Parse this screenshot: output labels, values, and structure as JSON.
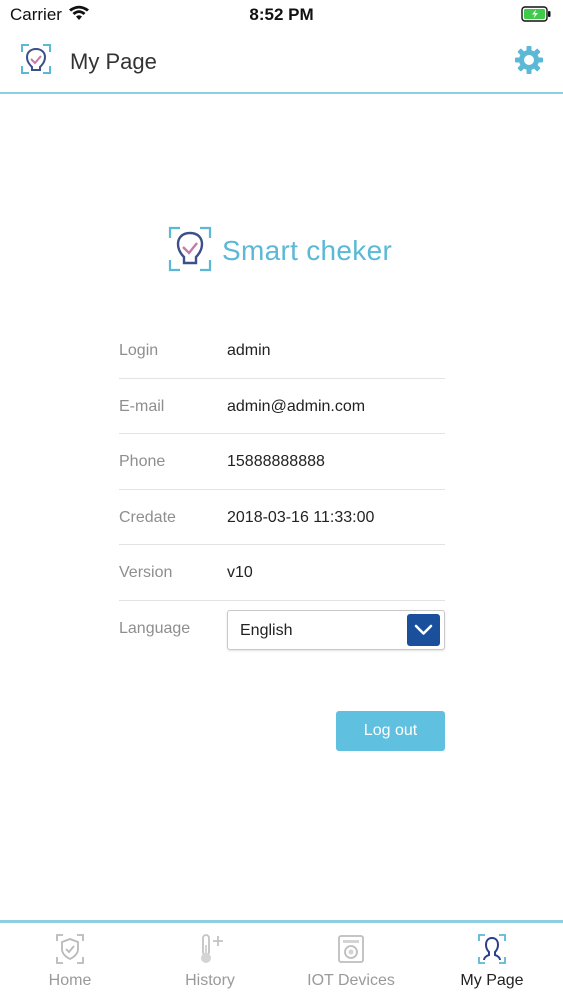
{
  "status_bar": {
    "carrier": "Carrier",
    "time": "8:52 PM",
    "battery_color": "#3ecb49"
  },
  "header": {
    "title": "My Page",
    "logo_icon": "smart-checker-logo-icon",
    "settings_icon": "gear-icon",
    "accent_color": "#5bb8d6"
  },
  "brand": {
    "name": "Smart cheker"
  },
  "profile": {
    "rows": [
      {
        "label": "Login",
        "value": "admin"
      },
      {
        "label": "E-mail",
        "value": "admin@admin.com"
      },
      {
        "label": "Phone",
        "value": "15888888888"
      },
      {
        "label": "Credate",
        "value": "2018-03-16 11:33:00"
      },
      {
        "label": "Version",
        "value": "v10"
      }
    ],
    "language": {
      "label": "Language",
      "selected": "English"
    }
  },
  "actions": {
    "logout_label": "Log out"
  },
  "tabs": [
    {
      "label": "Home",
      "icon": "home-shield-icon",
      "active": false
    },
    {
      "label": "History",
      "icon": "thermometer-icon",
      "active": false
    },
    {
      "label": "IOT Devices",
      "icon": "iot-device-icon",
      "active": false
    },
    {
      "label": "My Page",
      "icon": "user-icon",
      "active": true
    }
  ]
}
